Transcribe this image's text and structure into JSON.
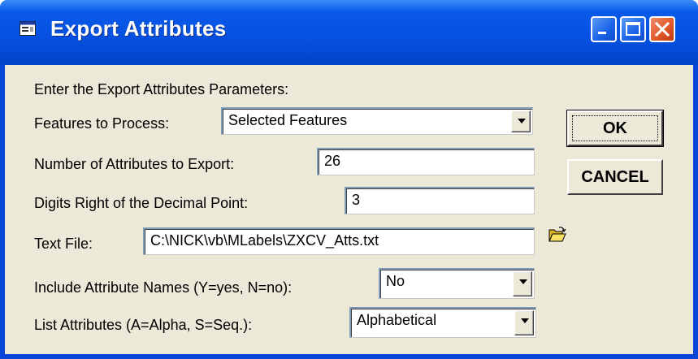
{
  "window": {
    "title": "Export Attributes",
    "icon": "form-icon",
    "controls": [
      "minimize",
      "maximize",
      "close"
    ]
  },
  "form": {
    "header": "Enter the Export Attributes Parameters:",
    "features": {
      "label": "Features to Process:",
      "value": "Selected Features"
    },
    "num_attributes": {
      "label": "Number of Attributes to Export:",
      "value": "26"
    },
    "digits": {
      "label": "Digits Right of the Decimal Point:",
      "value": "3"
    },
    "text_file": {
      "label": "Text File:",
      "value": "C:\\NICK\\vb\\MLabels\\ZXCV_Atts.txt",
      "browse_icon": "open-folder-icon"
    },
    "include_names": {
      "label": "Include Attribute Names (Y=yes, N=no):",
      "value": "No"
    },
    "list_attributes": {
      "label": "List Attributes (A=Alpha, S=Seq.):",
      "value": "Alphabetical"
    }
  },
  "buttons": {
    "ok": "OK",
    "cancel": "CANCEL"
  },
  "colors": {
    "titlebar": "#0550e0",
    "dialog_bg": "#ece9d8",
    "close": "#e05a2a"
  }
}
